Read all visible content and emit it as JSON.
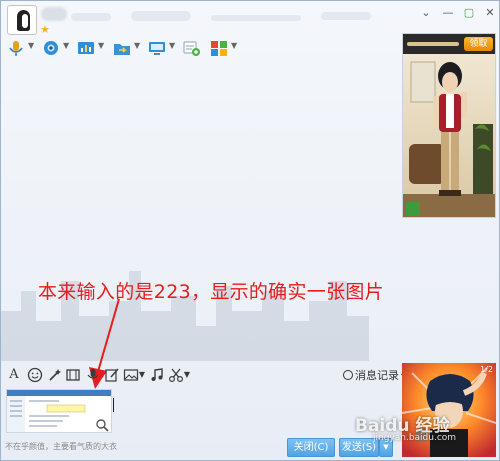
{
  "window": {
    "controls": {
      "settings": "⌄",
      "minimize": "—",
      "maximize": "▢",
      "close": "✕"
    }
  },
  "toolbar": {
    "items": [
      {
        "name": "voice-call-button",
        "icon": "microphone-icon",
        "color": "#e6a21a"
      },
      {
        "name": "video-call-button",
        "icon": "camera-icon",
        "color": "#2f8fd8"
      },
      {
        "name": "screen-share-button",
        "icon": "chart-icon",
        "color": "#2f8fd8"
      },
      {
        "name": "file-transfer-button",
        "icon": "folder-icon",
        "color": "#3a93d6"
      },
      {
        "name": "remote-desktop-button",
        "icon": "monitor-icon",
        "color": "#2f8fd8"
      },
      {
        "name": "create-group-button",
        "icon": "add-user-icon",
        "color": "#4bb04a"
      },
      {
        "name": "apps-button",
        "icon": "grid-icon",
        "color": "#e5492d"
      }
    ]
  },
  "annotation": {
    "text": "本来输入的是223，显示的确实一张图片"
  },
  "format_bar": {
    "items": [
      "font-icon",
      "emoji-icon",
      "magic-icon",
      "video-clip-icon",
      "voice-icon",
      "edit-icon",
      "image-icon",
      "music-icon",
      "scissors-icon"
    ],
    "font_label": "A",
    "history_label": "消息记录"
  },
  "input": {
    "hint": "不在乎颜值，主要看气质的大衣"
  },
  "buttons": {
    "close_label": "关闭(C)",
    "send_label": "发送(S)"
  },
  "side_panel": {
    "claim_label": "领取",
    "page_indicator": "1/2"
  },
  "watermark": {
    "text": "Baidu 经验",
    "sub": "jingyan.baidu.com"
  },
  "colors": {
    "accent": "#4fa3e4",
    "annotation": "#e81c1c",
    "claim": "#f29a0e"
  }
}
